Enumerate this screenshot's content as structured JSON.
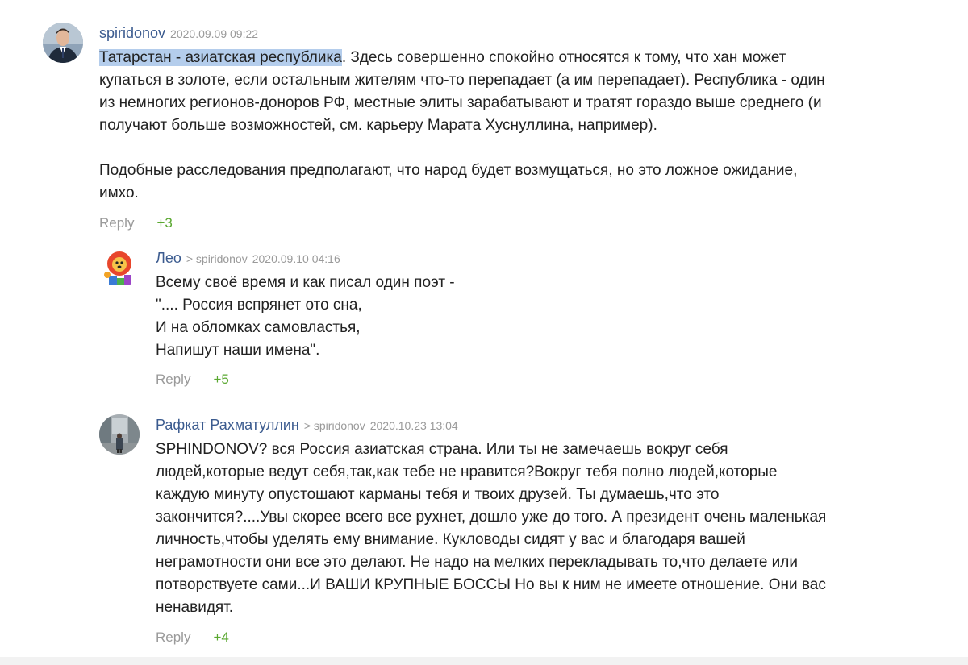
{
  "comments": [
    {
      "author": "spiridonov",
      "reply_to": "",
      "date": "2020.09.09 09:22",
      "highlight": "Татарстан - азиатская республика",
      "lines": [
        ". Здесь совершенно спокойно относятся к тому, что хан может",
        "купаться в золоте, если остальным жителям что-то перепадает (а им перепадает). Республика - один",
        "из немногих регионов-доноров РФ, местные элиты зарабатывают и тратят гораздо выше среднего (и",
        "получают больше возможностей, см. карьеру Марата Хуснуллина, например).",
        "",
        "Подобные расследования предполагают, что народ будет возмущаться, но это ложное ожидание,",
        "имхо."
      ],
      "reply_label": "Reply",
      "score": "+3"
    },
    {
      "author": "Лео",
      "reply_to": "> spiridonov",
      "date": "2020.09.10 04:16",
      "lines": [
        "Всему своё время и как писал один поэт -",
        "\".... Россия вспрянет ото сна,",
        "И на обломках самовластья,",
        "Напишут наши имена\"."
      ],
      "reply_label": "Reply",
      "score": "+5"
    },
    {
      "author": "Рафкат Рахматуллин",
      "reply_to": "> spiridonov",
      "date": "2020.10.23 13:04",
      "lines": [
        "SPHINDONOV? вся Россия азиатская страна. Или ты не замечаешь вокруг себя",
        "людей,которые ведут себя,так,как тебе не нравится?Вокруг тебя полно людей,которые",
        "каждую минуту опустошают карманы тебя и твоих друзей. Ты думаешь,что это",
        "закончится?....Увы скорее всего все рухнет, дошло уже до того. А президент очень маленькая",
        "личность,чтобы уделять ему внимание. Кукловоды сидят у вас и благодаря вашей",
        "неграмотности они все это делают. Не надо на мелких перекладывать то,что делаете или",
        "потворствуете сами...И ВАШИ КРУПНЫЕ БОССЫ Но вы к ним не имеете отношение. Они вас",
        "ненавидят."
      ],
      "reply_label": "Reply",
      "score": "+4"
    }
  ]
}
